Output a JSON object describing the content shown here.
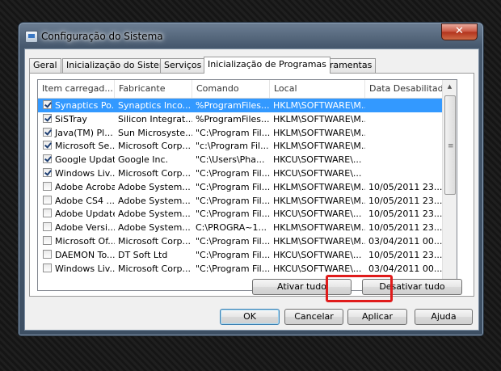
{
  "window": {
    "title": "Configuração do Sistema",
    "close_glyph": "✕"
  },
  "tabs": [
    "Geral",
    "Inicialização do Sistema",
    "Serviços",
    "Inicialização de Programas",
    "Ferramentas"
  ],
  "active_tab": "Inicialização de Programas",
  "columns": [
    "Item carregad...",
    "Fabricante",
    "Comando",
    "Local",
    "Data Desabilitada"
  ],
  "rows": [
    {
      "checked": true,
      "selected": true,
      "item": "Synaptics Po...",
      "maker": "Synaptics Inco...",
      "command": "%ProgramFiles...",
      "location": "HKLM\\SOFTWARE\\M...",
      "date": ""
    },
    {
      "checked": true,
      "selected": false,
      "item": "SiSTray",
      "maker": "Silicon Integrat...",
      "command": "%ProgramFiles...",
      "location": "HKLM\\SOFTWARE\\M...",
      "date": ""
    },
    {
      "checked": true,
      "selected": false,
      "item": "Java(TM) Pl...",
      "maker": "Sun Microsyste...",
      "command": "\"C:\\Program Fil...",
      "location": "HKLM\\SOFTWARE\\M...",
      "date": ""
    },
    {
      "checked": true,
      "selected": false,
      "item": "Microsoft Se...",
      "maker": "Microsoft Corp...",
      "command": "\"c:\\Program Fil...",
      "location": "HKLM\\SOFTWARE\\M...",
      "date": ""
    },
    {
      "checked": true,
      "selected": false,
      "item": "Google Update",
      "maker": "Google Inc.",
      "command": "\"C:\\Users\\Pha...",
      "location": "HKCU\\SOFTWARE\\...",
      "date": ""
    },
    {
      "checked": true,
      "selected": false,
      "item": "Windows Liv...",
      "maker": "Microsoft Corp...",
      "command": "\"C:\\Program Fil...",
      "location": "HKCU\\SOFTWARE\\...",
      "date": ""
    },
    {
      "checked": false,
      "selected": false,
      "item": "Adobe Acrobat",
      "maker": "Adobe System...",
      "command": "\"C:\\Program Fil...",
      "location": "HKLM\\SOFTWARE\\M...",
      "date": "10/05/2011 23..."
    },
    {
      "checked": false,
      "selected": false,
      "item": "Adobe CS4 ...",
      "maker": "Adobe System...",
      "command": "\"C:\\Program Fil...",
      "location": "HKLM\\SOFTWARE\\M...",
      "date": "10/05/2011 23..."
    },
    {
      "checked": false,
      "selected": false,
      "item": "Adobe Updater",
      "maker": "Adobe System...",
      "command": "\"C:\\Program Fil...",
      "location": "HKCU\\SOFTWARE\\...",
      "date": "10/05/2011 23..."
    },
    {
      "checked": false,
      "selected": false,
      "item": "Adobe Versi...",
      "maker": "Adobe System...",
      "command": "C:\\PROGRA~1...",
      "location": "HKLM\\SOFTWARE\\M...",
      "date": "10/05/2011 23..."
    },
    {
      "checked": false,
      "selected": false,
      "item": "Microsoft Of...",
      "maker": "Microsoft Corp...",
      "command": "\"C:\\Program Fil...",
      "location": "HKLM\\SOFTWARE\\M...",
      "date": "03/04/2011 00..."
    },
    {
      "checked": false,
      "selected": false,
      "item": "DAEMON To...",
      "maker": "DT Soft Ltd",
      "command": "\"C:\\Program Fil...",
      "location": "HKCU\\SOFTWARE\\...",
      "date": "10/05/2011 23..."
    },
    {
      "checked": false,
      "selected": false,
      "item": "Windows Liv...",
      "maker": "Microsoft Corp...",
      "command": "\"C:\\Program Fil...",
      "location": "HKCU\\SOFTWARE\\...",
      "date": "03/04/2011 00..."
    }
  ],
  "list_buttons": {
    "enable_all": "Ativar tudo",
    "disable_all": "Desativar tudo"
  },
  "dialog_buttons": {
    "ok": "OK",
    "cancel": "Cancelar",
    "apply": "Aplicar",
    "help": "Ajuda"
  },
  "scroll": {
    "up": "▲",
    "down": "▼",
    "grip": "≡"
  }
}
